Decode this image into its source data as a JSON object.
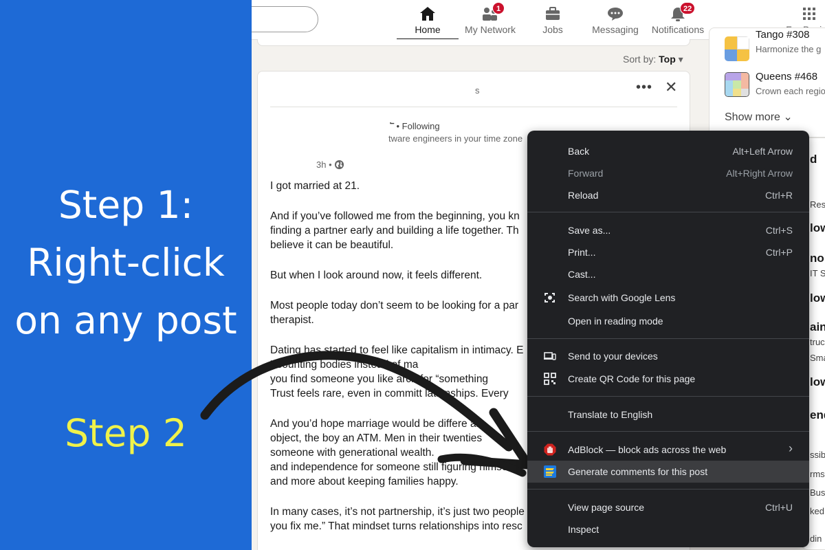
{
  "left_panel": {
    "step1_line1": "Step 1:",
    "step1_line2": "Right-click",
    "step1_line3": "on any post",
    "step2": "Step 2",
    "bg_color": "#1e6ad6",
    "step2_color": "#f0f24a"
  },
  "nav": {
    "items": [
      {
        "label": "Home",
        "icon": "home-icon",
        "active": true
      },
      {
        "label": "My Network",
        "icon": "network-icon",
        "badge": "1"
      },
      {
        "label": "Jobs",
        "icon": "briefcase-icon"
      },
      {
        "label": "Messaging",
        "icon": "messaging-icon"
      },
      {
        "label": "Notifications",
        "icon": "bell-icon",
        "badge": "22"
      },
      {
        "label": "For Busine",
        "icon": "grid-icon"
      }
    ]
  },
  "feed": {
    "sort_label": "Sort by:",
    "sort_value": "Top",
    "post": {
      "header_text": "s",
      "following": "• Following",
      "tagline": "tware engineers in your time zone",
      "time": "3h •",
      "paragraphs": [
        "I got married at 21.",
        "And if you’ve followed me from the beginning, you kn\nfinding a partner early and building a life together. Th\nbelieve it can be beautiful.",
        "But when I look around now, it feels different.",
        "Most people today don’t seem to be looking for a par\ntherapist.",
        "Dating has started to feel like capitalism in intimacy. E\n“                    counting bodies instead of ma\nyou find someone you like       arch for “something\nTrust feels rare, even in committ          lationships. Every",
        "And you’d hope marriage would be differe          ar\nobject, the boy an ATM. Men in their twenties\nsomeone with generational wealth.\nand independence for someone still figuring himself o\nand more about keeping families happy.",
        "In many cases, it’s not partnership, it’s just two people\nyou fix me.” That mindset turns relationships into resc"
      ]
    }
  },
  "right_rail": {
    "games": [
      {
        "title": "Tango #308",
        "subtitle": "Harmonize the g"
      },
      {
        "title": "Queens #468",
        "subtitle": "Crown each regio"
      }
    ],
    "show_more": "Show more",
    "fragments": [
      "d",
      "Res",
      "low",
      "no T",
      "IT S",
      "low",
      "ain",
      "truc",
      "Sma",
      "low",
      "end",
      "ssib",
      "rms",
      "Bus",
      "ked",
      "din"
    ]
  },
  "context_menu": {
    "items": [
      {
        "label": "Back",
        "shortcut": "Alt+Left Arrow"
      },
      {
        "label": "Forward",
        "shortcut": "Alt+Right Arrow",
        "disabled": true
      },
      {
        "label": "Reload",
        "shortcut": "Ctrl+R"
      },
      {
        "label": "Save as...",
        "shortcut": "Ctrl+S"
      },
      {
        "label": "Print...",
        "shortcut": "Ctrl+P"
      },
      {
        "label": "Cast..."
      },
      {
        "label": "Search with Google Lens",
        "icon": "lens-icon"
      },
      {
        "label": "Open in reading mode"
      },
      {
        "label": "Send to your devices",
        "icon": "devices-icon"
      },
      {
        "label": "Create QR Code for this page",
        "icon": "qr-code-icon"
      },
      {
        "label": "Translate to English"
      },
      {
        "label": "AdBlock — block ads across the web",
        "icon": "adblock-icon",
        "submenu": "›"
      },
      {
        "label": "Generate comments for this post",
        "icon": "extension-icon",
        "highlight": true
      },
      {
        "label": "View page source",
        "shortcut": "Ctrl+U"
      },
      {
        "label": "Inspect"
      }
    ]
  }
}
